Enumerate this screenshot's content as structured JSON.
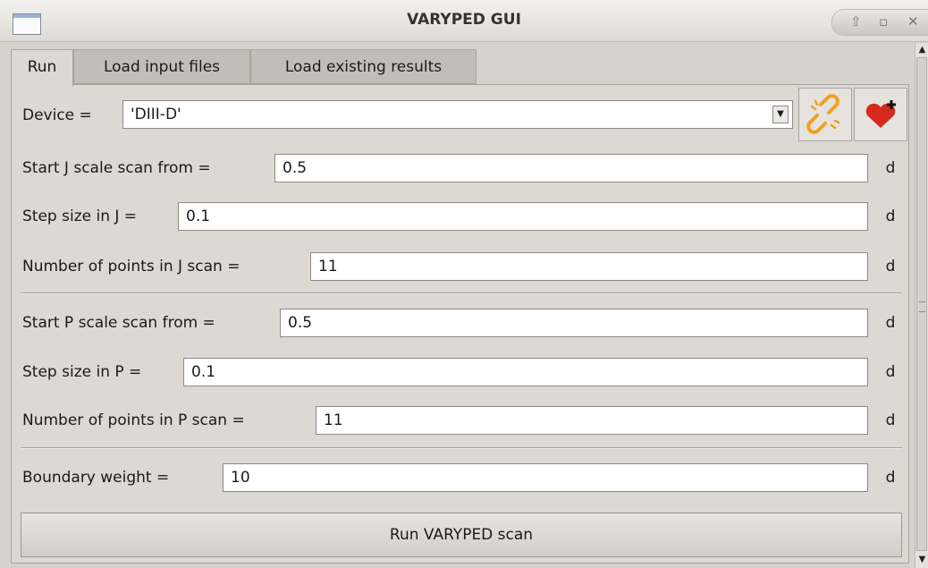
{
  "window": {
    "title": "VARYPED GUI"
  },
  "tabs": [
    "Run",
    "Load input files",
    "Load existing results"
  ],
  "device": {
    "label": "Device =",
    "value": "'DIII-D'"
  },
  "fields": {
    "j_start": {
      "label": "Start J scale scan from =",
      "value": "0.5",
      "unit": "d"
    },
    "j_step": {
      "label": "Step size in J =",
      "value": "0.1",
      "unit": "d"
    },
    "j_num": {
      "label": "Number of points in J scan =",
      "value": "11",
      "unit": "d"
    },
    "p_start": {
      "label": "Start P scale scan from =",
      "value": "0.5",
      "unit": "d"
    },
    "p_step": {
      "label": "Step size in P =",
      "value": "0.1",
      "unit": "d"
    },
    "p_num": {
      "label": "Number of points in P scan =",
      "value": "11",
      "unit": "d"
    },
    "bweight": {
      "label": "Boundary weight =",
      "value": "10",
      "unit": "d"
    }
  },
  "run_button": "Run VARYPED scan",
  "icons": {
    "link": "broken-link-icon",
    "favorite": "heart-plus-icon",
    "link_color": "#f0a020",
    "heart_color": "#d42a1c"
  }
}
